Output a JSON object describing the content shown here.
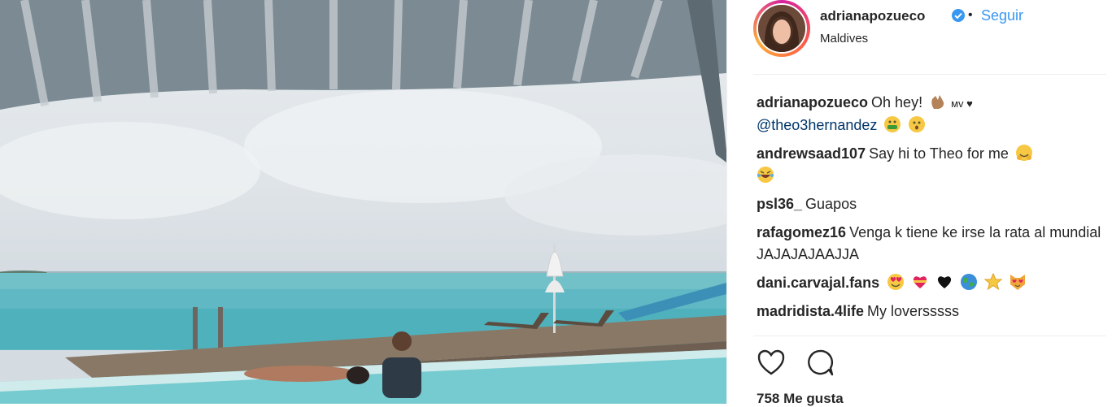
{
  "post": {
    "author": "adrianapozueco",
    "verified": true,
    "follow_label": "Seguir",
    "separator": "•",
    "location": "Maldives"
  },
  "caption": {
    "user": "adrianapozueco",
    "text": "Oh hey!",
    "suffix": "ᴍᴠ ♥",
    "mention": "@theo3hernandez"
  },
  "comments": [
    {
      "user": "andrewsaad107",
      "text": "Say hi to Theo for me"
    },
    {
      "user": "psl36_",
      "text": "Guapos"
    },
    {
      "user": "rafagomez16",
      "text": "Venga k tiene ke irse la rata al mundial JAJAJAJAAJJA"
    },
    {
      "user": "dani.carvajal.fans",
      "text": ""
    },
    {
      "user": "madridista.4life",
      "text": "My loversssss"
    }
  ],
  "likes": "758 Me gusta",
  "icons": {
    "like": "heart-icon",
    "comment": "comment-bubble-icon",
    "verified": "verified-badge-icon"
  },
  "colors": {
    "link": "#3897f0",
    "verified": "#3897f0",
    "mention": "#003569"
  }
}
